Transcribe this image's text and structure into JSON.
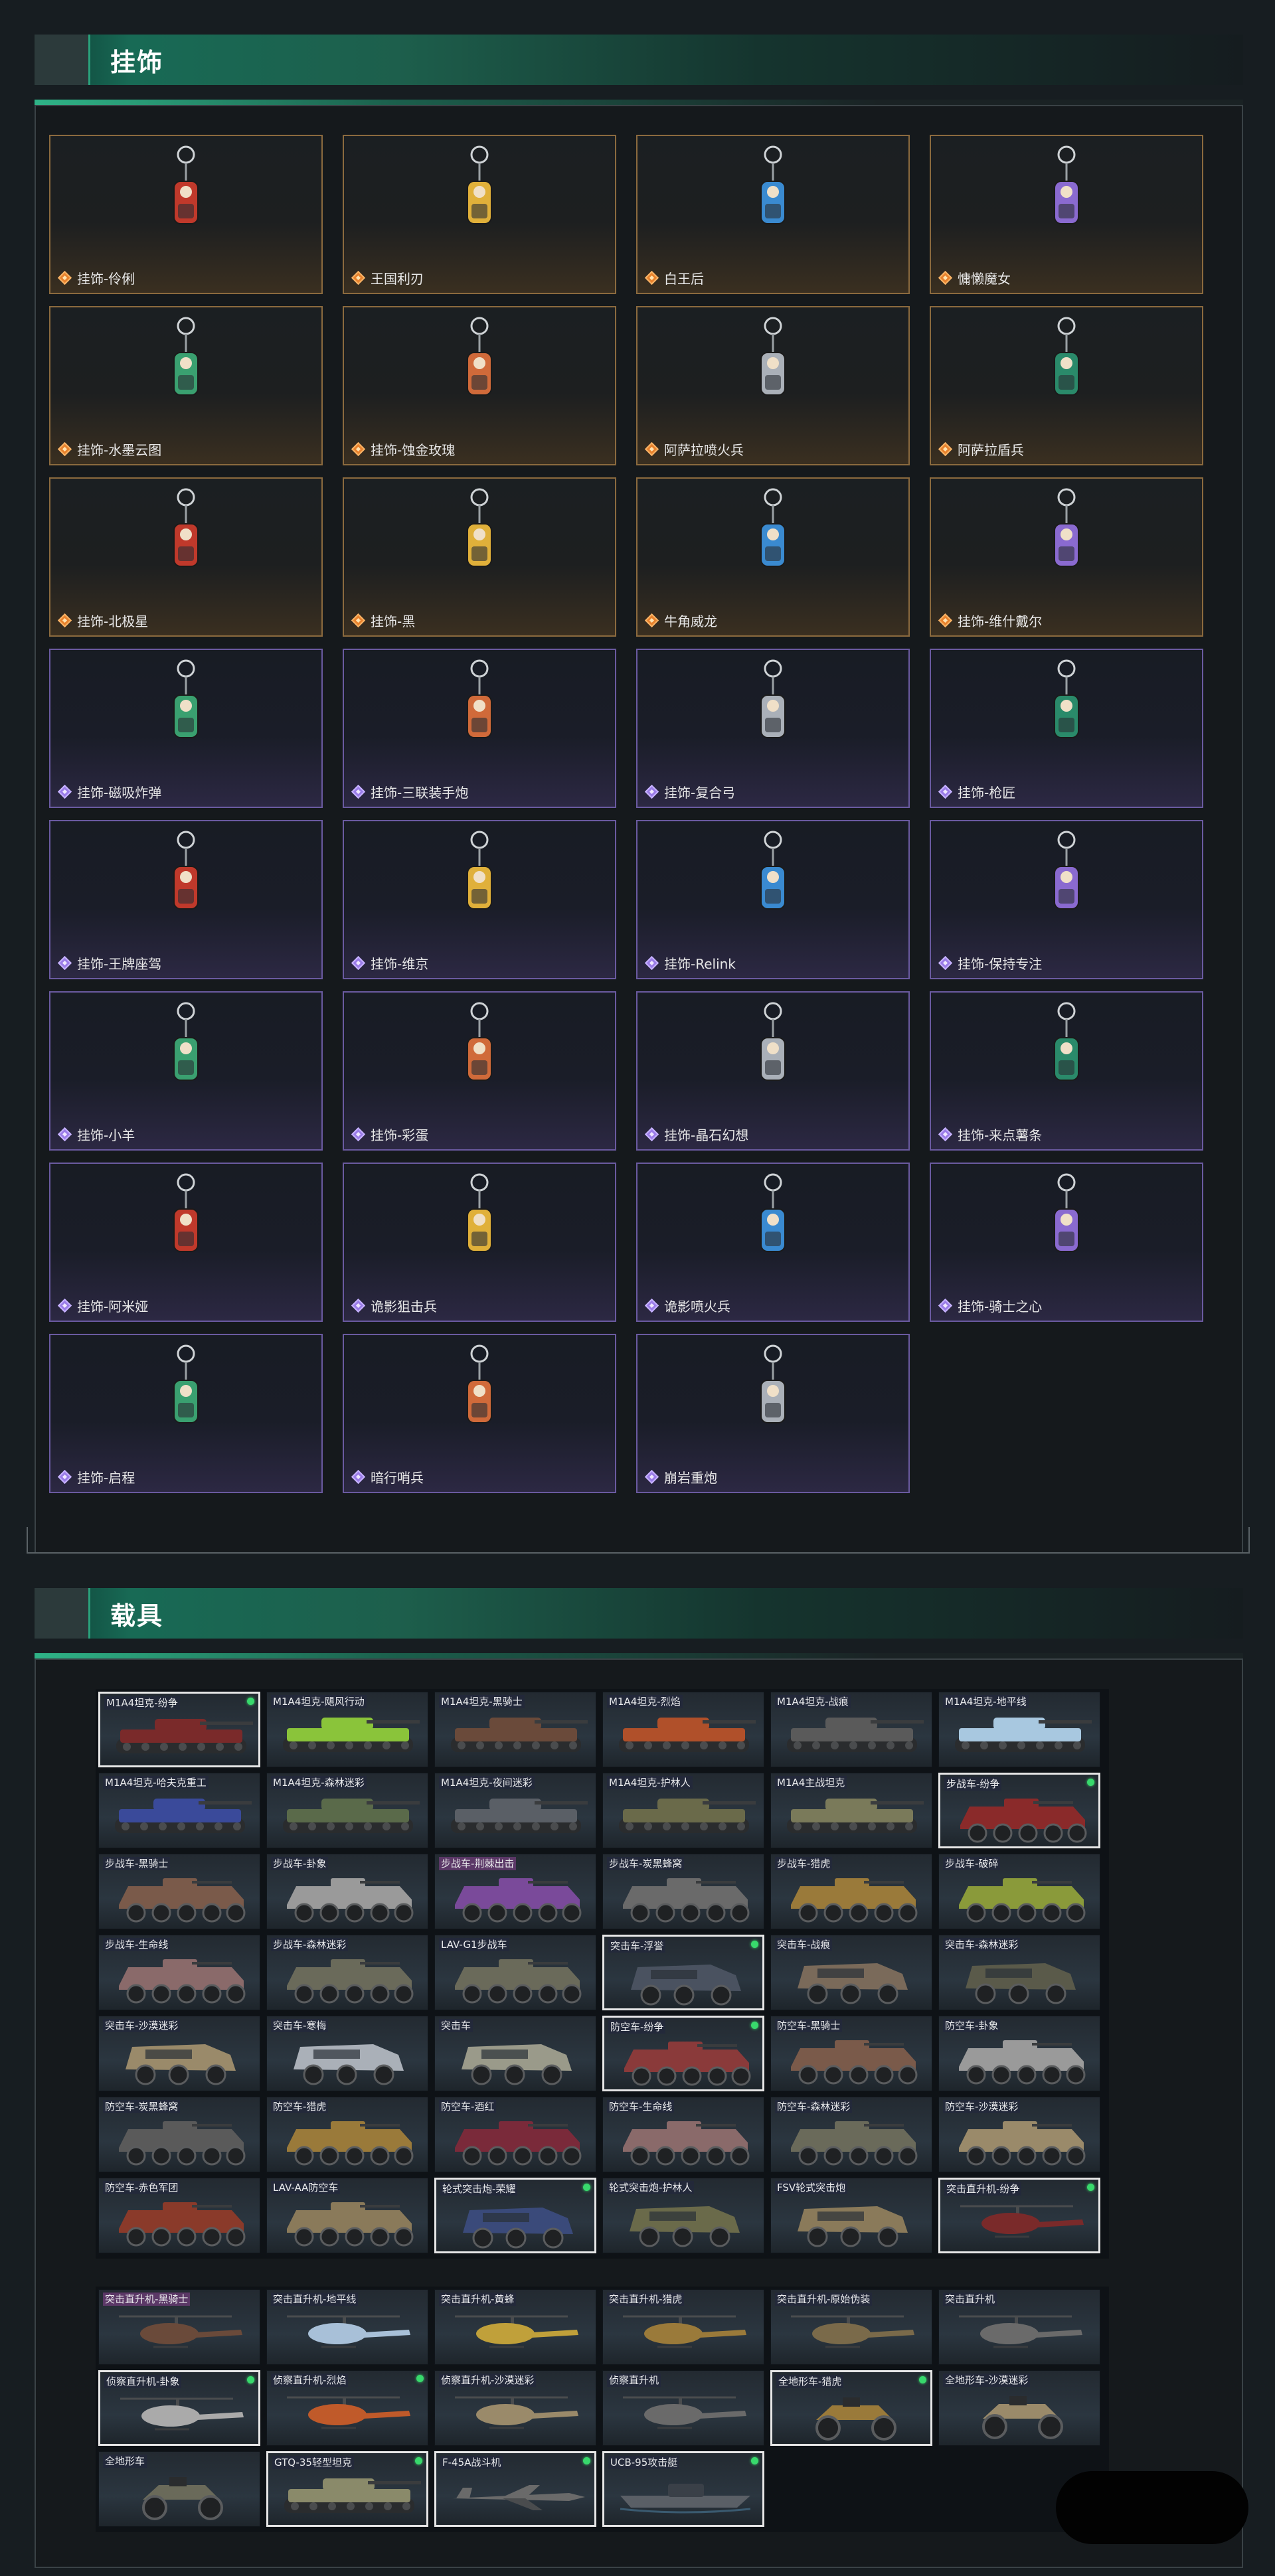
{
  "sections": {
    "pendants_title": "挂饰",
    "vehicles_title": "载具"
  },
  "pendants": [
    {
      "label": "挂饰-伶俐",
      "rarity": "orange",
      "icon": "blade-charm-icon"
    },
    {
      "label": "王国利刃",
      "rarity": "orange",
      "icon": "knight-figure-icon"
    },
    {
      "label": "白王后",
      "rarity": "orange",
      "icon": "queen-figure-icon"
    },
    {
      "label": "慵懒魔女",
      "rarity": "orange",
      "icon": "witch-figure-icon"
    },
    {
      "label": "挂饰-水墨云图",
      "rarity": "orange",
      "icon": "dice-charm-icon"
    },
    {
      "label": "挂饰-蚀金玫瑰",
      "rarity": "orange",
      "icon": "rose-emblem-icon"
    },
    {
      "label": "阿萨拉喷火兵",
      "rarity": "orange",
      "icon": "soldier-figure-icon"
    },
    {
      "label": "阿萨拉盾兵",
      "rarity": "orange",
      "icon": "shield-soldier-icon"
    },
    {
      "label": "挂饰-北极星",
      "rarity": "orange",
      "icon": "star-charm-icon"
    },
    {
      "label": "挂饰-黑",
      "rarity": "orange",
      "icon": "tag-charm-icon"
    },
    {
      "label": "牛角威龙",
      "rarity": "orange",
      "icon": "horn-figure-icon"
    },
    {
      "label": "挂饰-维什戴尔",
      "rarity": "orange",
      "icon": "tag-charm-icon"
    },
    {
      "label": "挂饰-磁吸炸弹",
      "rarity": "purple",
      "icon": "bomb-charm-icon"
    },
    {
      "label": "挂饰-三联装手炮",
      "rarity": "purple",
      "icon": "cannon-charm-icon"
    },
    {
      "label": "挂饰-复合弓",
      "rarity": "purple",
      "icon": "bow-charm-icon"
    },
    {
      "label": "挂饰-枪匠",
      "rarity": "purple",
      "icon": "gunsmith-charm-icon"
    },
    {
      "label": "挂饰-王牌座驾",
      "rarity": "purple",
      "icon": "jet-charm-icon"
    },
    {
      "label": "挂饰-维京",
      "rarity": "purple",
      "icon": "axe-charm-icon"
    },
    {
      "label": "挂饰-Relink",
      "rarity": "purple",
      "icon": "relink-charm-icon"
    },
    {
      "label": "挂饰-保持专注",
      "rarity": "purple",
      "icon": "sign-charm-icon"
    },
    {
      "label": "挂饰-小羊",
      "rarity": "purple",
      "icon": "lamb-charm-icon"
    },
    {
      "label": "挂饰-彩蛋",
      "rarity": "purple",
      "icon": "egg-charm-icon"
    },
    {
      "label": "挂饰-晶石幻想",
      "rarity": "purple",
      "icon": "crystal-charm-icon"
    },
    {
      "label": "挂饰-来点薯条",
      "rarity": "purple",
      "icon": "fries-charm-icon"
    },
    {
      "label": "挂饰-阿米娅",
      "rarity": "purple",
      "icon": "bunny-charm-icon"
    },
    {
      "label": "诡影狙击兵",
      "rarity": "purple",
      "icon": "sniper-figure-icon"
    },
    {
      "label": "诡影喷火兵",
      "rarity": "purple",
      "icon": "flamer-figure-icon"
    },
    {
      "label": "挂饰-骑士之心",
      "rarity": "purple",
      "icon": "heart-charm-icon"
    },
    {
      "label": "挂饰-启程",
      "rarity": "purple",
      "icon": "compass-charm-icon"
    },
    {
      "label": "暗行哨兵",
      "rarity": "purple",
      "icon": "sentry-figure-icon"
    },
    {
      "label": "崩岩重炮",
      "rarity": "purple",
      "icon": "gunner-figure-icon"
    }
  ],
  "vehicles_group1": [
    {
      "label": "M1A4坦克-纷争",
      "kind": "tank",
      "color": "#7a2a2a",
      "selected": true,
      "dot": true
    },
    {
      "label": "M1A4坦克-飓风行动",
      "kind": "tank",
      "color": "#8ac43a"
    },
    {
      "label": "M1A4坦克-黑骑士",
      "kind": "tank",
      "color": "#6a4a3a"
    },
    {
      "label": "M1A4坦克-烈焰",
      "kind": "tank",
      "color": "#b0502a"
    },
    {
      "label": "M1A4坦克-战痕",
      "kind": "tank",
      "color": "#5a5a5a"
    },
    {
      "label": "M1A4坦克-地平线",
      "kind": "tank",
      "color": "#a8c8e0"
    },
    {
      "label": "M1A4坦克-哈夫克重工",
      "kind": "tank",
      "color": "#3a4a9a"
    },
    {
      "label": "M1A4坦克-森林迷彩",
      "kind": "tank",
      "color": "#5a6a4a"
    },
    {
      "label": "M1A4坦克-夜间迷彩",
      "kind": "tank",
      "color": "#5a5f66"
    },
    {
      "label": "M1A4坦克-护林人",
      "kind": "tank",
      "color": "#6a6a4a"
    },
    {
      "label": "M1A4主战坦克",
      "kind": "tank",
      "color": "#7a7a5a"
    },
    {
      "label": "步战车-纷争",
      "kind": "apc",
      "color": "#8a2a2a",
      "selected": true,
      "dot": true
    },
    {
      "label": "步战车-黑骑士",
      "kind": "apc",
      "color": "#7a5a4a"
    },
    {
      "label": "步战车-卦象",
      "kind": "apc",
      "color": "#9a9a9a"
    },
    {
      "label": "步战车-荆棘出击",
      "kind": "apc",
      "color": "#7a4a9a",
      "pink": true
    },
    {
      "label": "步战车-炭黑蜂窝",
      "kind": "apc",
      "color": "#6a6a6a"
    },
    {
      "label": "步战车-猎虎",
      "kind": "apc",
      "color": "#9a7a3a"
    },
    {
      "label": "步战车-破碎",
      "kind": "apc",
      "color": "#8a9a3a"
    },
    {
      "label": "步战车-生命线",
      "kind": "apc",
      "color": "#8a6a6a"
    },
    {
      "label": "步战车-森林迷彩",
      "kind": "apc",
      "color": "#6a6a5a"
    },
    {
      "label": "LAV-G1步战车",
      "kind": "apc",
      "color": "#6a6a5a"
    },
    {
      "label": "突击车-浮誉",
      "kind": "truck",
      "color": "#4a5260",
      "selected": true,
      "dot": true
    },
    {
      "label": "突击车-战痕",
      "kind": "truck",
      "color": "#7a6a5a"
    },
    {
      "label": "突击车-森林迷彩",
      "kind": "truck",
      "color": "#5a5a4a"
    },
    {
      "label": "突击车-沙漠迷彩",
      "kind": "truck",
      "color": "#9a8a6a"
    },
    {
      "label": "突击车-寒梅",
      "kind": "truck",
      "color": "#aab0b8"
    },
    {
      "label": "突击车",
      "kind": "truck",
      "color": "#9a9a8a"
    },
    {
      "label": "防空车-纷争",
      "kind": "apc",
      "color": "#8a3a3a",
      "selected": true,
      "dot": true
    },
    {
      "label": "防空车-黑骑士",
      "kind": "apc",
      "color": "#7a5a4a"
    },
    {
      "label": "防空车-卦象",
      "kind": "apc",
      "color": "#9a9a9a"
    },
    {
      "label": "防空车-炭黑蜂窝",
      "kind": "apc",
      "color": "#5a5a5a"
    },
    {
      "label": "防空车-猎虎",
      "kind": "apc",
      "color": "#9a7a3a"
    },
    {
      "label": "防空车-酒红",
      "kind": "apc",
      "color": "#7a2a3a"
    },
    {
      "label": "防空车-生命线",
      "kind": "apc",
      "color": "#8a6a6a"
    },
    {
      "label": "防空车-森林迷彩",
      "kind": "apc",
      "color": "#6a6a5a"
    },
    {
      "label": "防空车-沙漠迷彩",
      "kind": "apc",
      "color": "#9a8a6a"
    },
    {
      "label": "防空车-赤色军团",
      "kind": "apc",
      "color": "#8a3a2a"
    },
    {
      "label": "LAV-AA防空车",
      "kind": "apc",
      "color": "#8a7a5a"
    },
    {
      "label": "轮式突击炮-荣耀",
      "kind": "truck",
      "color": "#3a4a7a",
      "selected": true,
      "dot": true
    },
    {
      "label": "轮式突击炮-护林人",
      "kind": "truck",
      "color": "#6a6a4a"
    },
    {
      "label": "FSV轮式突击炮",
      "kind": "truck",
      "color": "#8a7a5a"
    },
    {
      "label": "突击直升机-纷争",
      "kind": "heli",
      "color": "#7a2a2a",
      "selected": true,
      "dot": true
    }
  ],
  "vehicles_group2": [
    {
      "label": "突击直升机-黑骑士",
      "kind": "heli",
      "color": "#6a4a3a",
      "pink": true
    },
    {
      "label": "突击直升机-地平线",
      "kind": "heli",
      "color": "#a8c0d8"
    },
    {
      "label": "突击直升机-黄蜂",
      "kind": "heli",
      "color": "#c0a03a"
    },
    {
      "label": "突击直升机-猎虎",
      "kind": "heli",
      "color": "#9a7a3a"
    },
    {
      "label": "突击直升机-原始伪装",
      "kind": "heli",
      "color": "#7a6a4a"
    },
    {
      "label": "突击直升机",
      "kind": "heli",
      "color": "#6a6a6a"
    },
    {
      "label": "侦察直升机-卦象",
      "kind": "heli",
      "color": "#aaaaaa",
      "selected": true,
      "dot": true
    },
    {
      "label": "侦察直升机-烈焰",
      "kind": "heli",
      "color": "#c05a2a",
      "dot": true
    },
    {
      "label": "侦察直升机-沙漠迷彩",
      "kind": "heli",
      "color": "#9a8a6a"
    },
    {
      "label": "侦察直升机",
      "kind": "heli",
      "color": "#6a6a6a"
    },
    {
      "label": "全地形车-猎虎",
      "kind": "atv",
      "color": "#9a7a3a",
      "selected": true,
      "dot": true
    },
    {
      "label": "全地形车-沙漠迷彩",
      "kind": "atv",
      "color": "#9a8a6a"
    },
    {
      "label": "全地形车",
      "kind": "atv",
      "color": "#6a6a5a"
    },
    {
      "label": "GTQ-35轻型坦克",
      "kind": "tank",
      "color": "#8a8a6a",
      "selected": true,
      "dot": true
    },
    {
      "label": "F-45A战斗机",
      "kind": "jet",
      "color": "#6a6a6a",
      "selected": true,
      "dot": true
    },
    {
      "label": "UCB-95攻击艇",
      "kind": "boat",
      "color": "#5a5f66",
      "selected": true,
      "dot": true
    }
  ],
  "colors": {
    "accent_green": "#2fb387",
    "orange_rarity": "#e8822d",
    "purple_rarity": "#9b7de8",
    "owned_dot": "#38d96c"
  }
}
